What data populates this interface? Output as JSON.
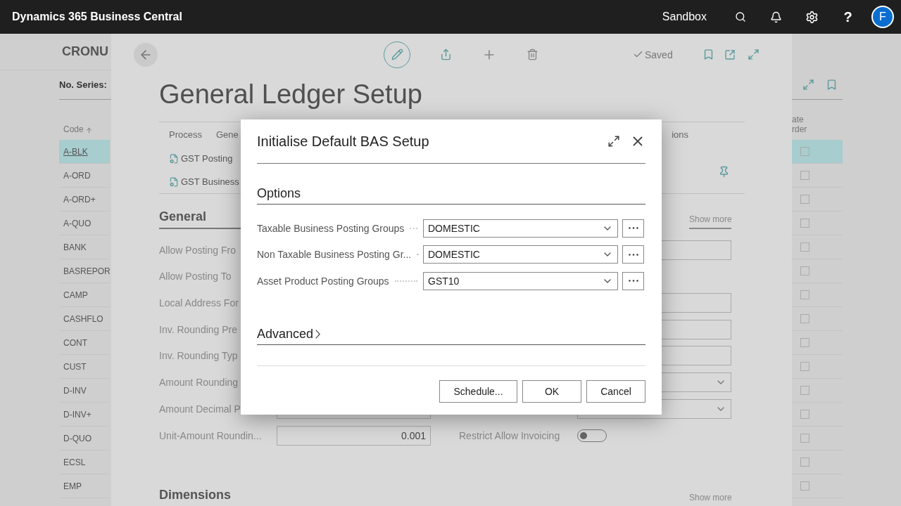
{
  "top_bar": {
    "app_title": "Dynamics 365 Business Central",
    "environment": "Sandbox",
    "help": "?",
    "avatar": "F"
  },
  "list_page": {
    "title": "CRONU",
    "filter_label": "No. Series:",
    "column": "Code",
    "right_header": [
      "ate",
      "rder"
    ],
    "rows": [
      {
        "code": "A-BLK",
        "selected": true,
        "checked": false
      },
      {
        "code": "A-ORD",
        "selected": false,
        "checked": false
      },
      {
        "code": "A-ORD+",
        "selected": false,
        "checked": false
      },
      {
        "code": "A-QUO",
        "selected": false,
        "checked": false
      },
      {
        "code": "BANK",
        "selected": false,
        "checked": false
      },
      {
        "code": "BASREPOR",
        "selected": false,
        "checked": false
      },
      {
        "code": "CAMP",
        "selected": false,
        "checked": false
      },
      {
        "code": "CASHFLO",
        "selected": false,
        "checked": false
      },
      {
        "code": "CONT",
        "selected": false,
        "checked": false
      },
      {
        "code": "CUST",
        "selected": false,
        "checked": false
      },
      {
        "code": "D-INV",
        "selected": false,
        "checked": false
      },
      {
        "code": "D-INV+",
        "selected": false,
        "checked": false
      },
      {
        "code": "D-QUO",
        "selected": false,
        "checked": false
      },
      {
        "code": "ECSL",
        "selected": false,
        "checked": false
      },
      {
        "code": "EMP",
        "selected": false,
        "checked": false
      }
    ]
  },
  "page": {
    "title": "General Ledger Setup",
    "saved": "Saved",
    "action_tabs": [
      "Process",
      "Gene"
    ],
    "action_tab_right": "ions",
    "actions": [
      "GST Posting",
      "GST Business"
    ],
    "general": {
      "heading": "General",
      "show_more": "Show more",
      "rows": [
        {
          "label": "Allow Posting Fro",
          "right": {
            "kind": "input"
          }
        },
        {
          "label": "Allow Posting To"
        },
        {
          "label": "Local Address For",
          "right": {
            "kind": "input"
          }
        },
        {
          "label": "Inv. Rounding Pre",
          "right": {
            "kind": "input"
          }
        },
        {
          "label": "Inv. Rounding Typ",
          "right": {
            "kind": "input"
          }
        },
        {
          "label": "Amount Rounding",
          "right": {
            "kind": "select"
          }
        },
        {
          "label": "Amount Decimal P",
          "field": {
            "kind": "input"
          },
          "right": {
            "kind": "select"
          }
        },
        {
          "label": "Unit-Amount Roundin...",
          "field": {
            "kind": "input",
            "value": "0.001"
          },
          "right": {
            "kind": "toggle",
            "label": "Restrict Allow Invoicing",
            "on": false
          }
        }
      ]
    },
    "dimensions": {
      "heading": "Dimensions",
      "show_more": "Show more"
    }
  },
  "dialog": {
    "title": "Initialise Default BAS Setup",
    "section": "Options",
    "options": [
      {
        "label": "Taxable Business Posting Groups",
        "value": "DOMESTIC"
      },
      {
        "label": "Non Taxable Business Posting Gr...",
        "value": "DOMESTIC"
      },
      {
        "label": "Asset Product Posting Groups",
        "value": "GST10"
      }
    ],
    "advanced": "Advanced",
    "buttons": [
      "Schedule...",
      "OK",
      "Cancel"
    ]
  }
}
